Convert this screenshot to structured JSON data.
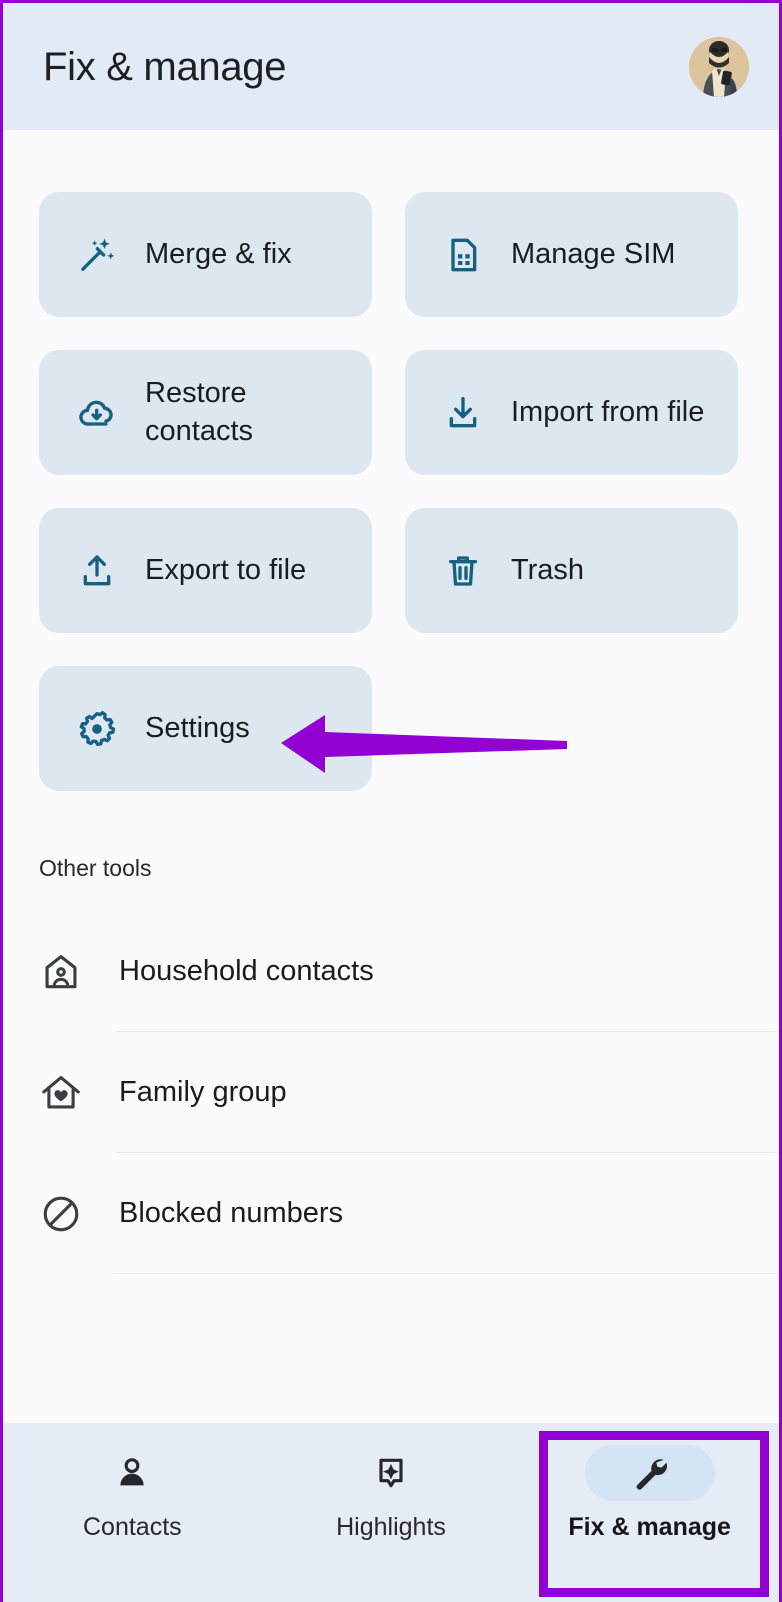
{
  "header": {
    "title": "Fix & manage",
    "avatar_name": "user-avatar"
  },
  "tiles": [
    {
      "label": "Merge & fix",
      "icon": "magic-wand-icon"
    },
    {
      "label": "Manage SIM",
      "icon": "sim-card-icon"
    },
    {
      "label": "Restore contacts",
      "icon": "cloud-restore-icon"
    },
    {
      "label": "Import from file",
      "icon": "import-download-icon"
    },
    {
      "label": "Export to file",
      "icon": "export-upload-icon"
    },
    {
      "label": "Trash",
      "icon": "trash-icon"
    },
    {
      "label": "Settings",
      "icon": "gear-icon"
    }
  ],
  "other_tools": {
    "section_title": "Other tools",
    "items": [
      {
        "label": "Household contacts",
        "icon": "house-person-icon"
      },
      {
        "label": "Family group",
        "icon": "house-heart-icon"
      },
      {
        "label": "Blocked numbers",
        "icon": "block-circle-icon"
      }
    ]
  },
  "bottom_nav": {
    "items": [
      {
        "label": "Contacts",
        "icon": "person-icon",
        "active": false
      },
      {
        "label": "Highlights",
        "icon": "sparkle-icon",
        "active": false
      },
      {
        "label": "Fix & manage",
        "icon": "wrench-icon",
        "active": true
      }
    ]
  },
  "annotations": {
    "arrow_color": "#9200d4",
    "box_color": "#9200d4",
    "arrow_points_to": "Settings",
    "box_highlights": "Fix & manage"
  },
  "colors": {
    "page_background": "#fbfbfd",
    "header_background": "#e2eaf5",
    "tile_background": "#dde7ef",
    "tile_icon": "#16617f",
    "nav_background": "#e6ecf6",
    "nav_active_pill": "#d3e4f5",
    "text_primary": "#1a1c1f",
    "accent_purple": "#9200d4"
  }
}
